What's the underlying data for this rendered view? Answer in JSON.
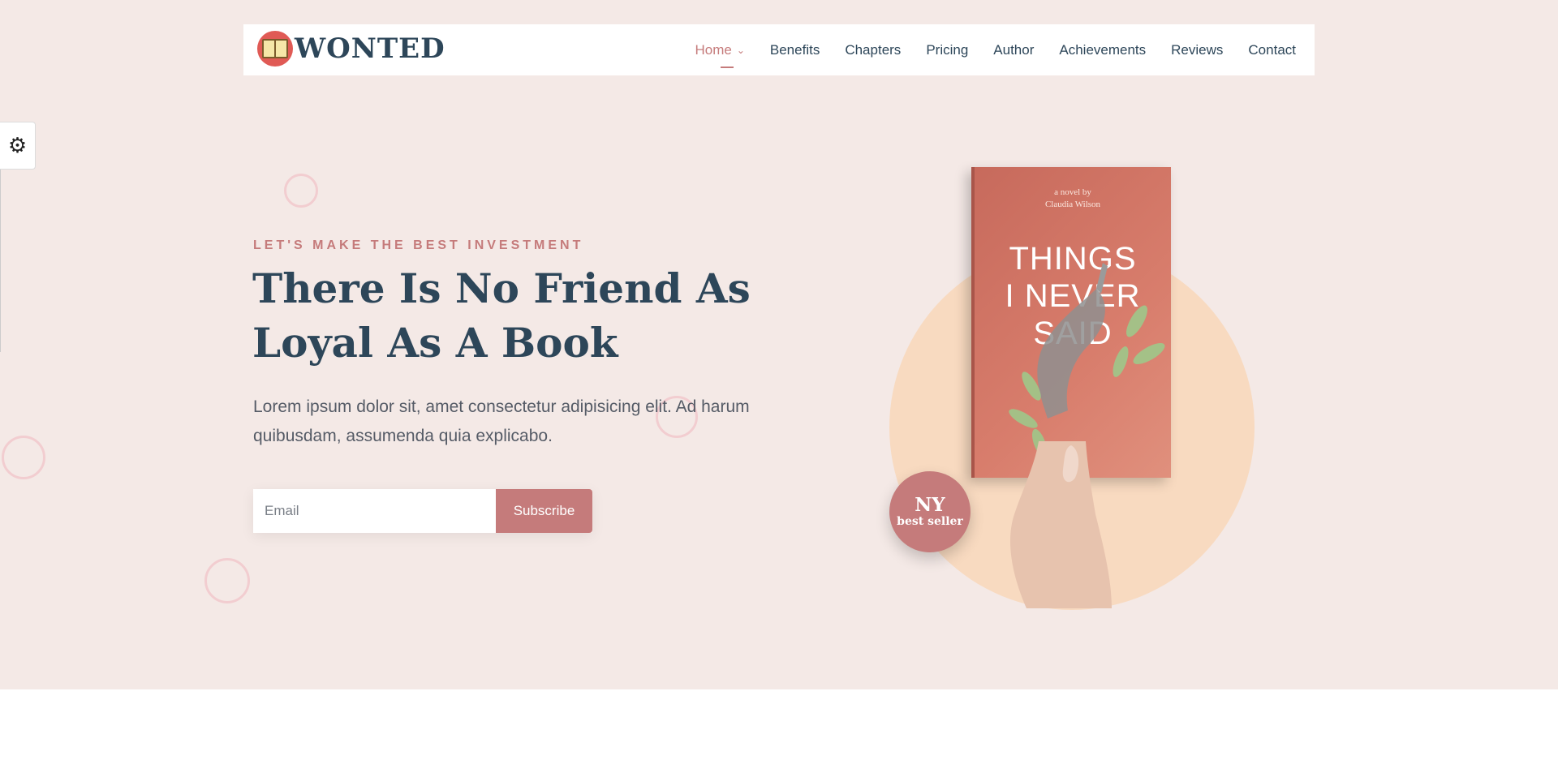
{
  "brand": {
    "name": "WONTED",
    "logo_icon": "open-book-icon"
  },
  "nav": {
    "items": [
      {
        "label": "Home",
        "active": true,
        "has_dropdown": true
      },
      {
        "label": "Benefits"
      },
      {
        "label": "Chapters"
      },
      {
        "label": "Pricing"
      },
      {
        "label": "Author"
      },
      {
        "label": "Achievements"
      },
      {
        "label": "Reviews"
      },
      {
        "label": "Contact"
      }
    ]
  },
  "settings": {
    "icon": "gears-icon"
  },
  "hero": {
    "kicker": "LET'S MAKE THE BEST INVESTMENT",
    "headline": "There Is No Friend As Loyal As A Book",
    "lead": "Lorem ipsum dolor sit, amet consectetur adipisicing elit. Ad harum quibusdam, assumenda quia explicabo.",
    "email_placeholder": "Email",
    "subscribe_label": "Subscribe"
  },
  "book": {
    "byline_1": "a novel by",
    "byline_2": "Claudia Wilson",
    "title_1": "THINGS",
    "title_2": "I NEVER",
    "title_3": "SAID"
  },
  "badge": {
    "top": "NY",
    "bottom": "best seller"
  },
  "colors": {
    "accent": "#c57b7b",
    "navy": "#2d4659",
    "hero_bg": "#f4e9e6",
    "circle_bg": "#f8dac0",
    "book_cover": "#d87d6c"
  }
}
